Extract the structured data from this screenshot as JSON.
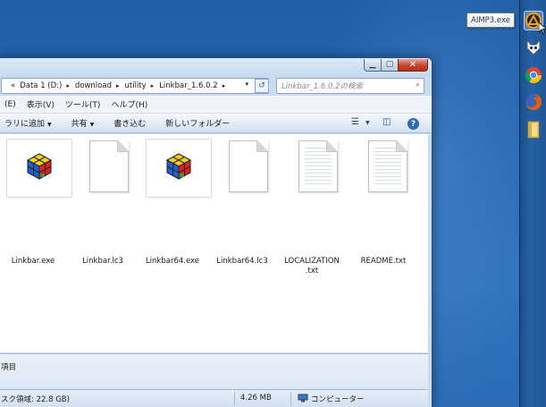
{
  "address": {
    "prefix": "«",
    "crumbs": [
      "Data 1 (D:)",
      "download",
      "utility",
      "Linkbar_1.6.0.2"
    ]
  },
  "search": {
    "placeholder": "Linkbar_1.6.0.2の検索"
  },
  "menu": [
    "(E)",
    "表示(V)",
    "ツール(T)",
    "ヘルプ(H)"
  ],
  "commands": {
    "include_library": "ラリに追加",
    "share": "共有",
    "burn": "書き込む",
    "new_folder": "新しいフォルダー"
  },
  "files": [
    {
      "name": "Linkbar.exe",
      "kind": "cube"
    },
    {
      "name": "Linkbar.lc3",
      "kind": "blank"
    },
    {
      "name": "Linkbar64.exe",
      "kind": "cube"
    },
    {
      "name": "Linkbar64.lc3",
      "kind": "blank"
    },
    {
      "name": "LOCALIZATION\n.txt",
      "kind": "text"
    },
    {
      "name": "README.txt",
      "kind": "text"
    }
  ],
  "details": {
    "item_count": "項目"
  },
  "status": {
    "free_space": "スク領域: 22.8 GB)",
    "size": "4.26 MB",
    "location": "コンピューター"
  },
  "linkbar": {
    "tooltip": "AIMP3.exe",
    "items": [
      "aimp-icon",
      "foobar-icon",
      "chrome-icon",
      "firefox-icon",
      "folder-icon"
    ]
  },
  "colors": {
    "desktop": "#2566b2",
    "window_frame": "#c9dcf1",
    "aimp": "#f0a020",
    "chrome_red": "#db4437",
    "firefox": "#e66000"
  }
}
